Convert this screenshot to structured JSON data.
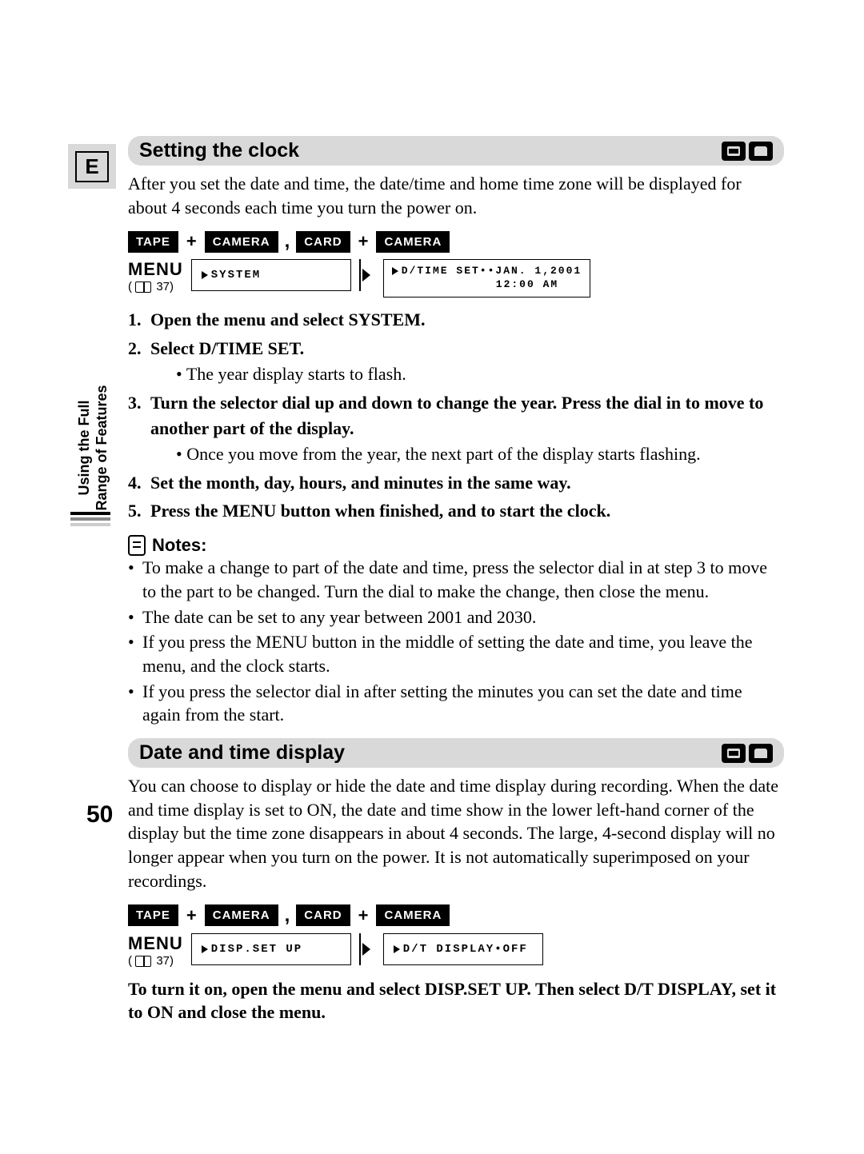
{
  "lang_box": "E",
  "side_label": "Using the Full\nRange of Features",
  "page_number": "50",
  "section1": {
    "title": "Setting the clock",
    "intro": "After you set the date and time, the date/time and home time zone will be displayed for about 4 seconds each time you turn the power on.",
    "tape_row": {
      "tape": "TAPE",
      "camera": "CAMERA",
      "card": "CARD"
    },
    "menu": {
      "label": "MENU",
      "ref_prefix": "(",
      "ref_num": "37)",
      "box1": "SYSTEM",
      "box2_line1": "D/TIME SET••JAN. 1,2001",
      "box2_line2": "12:00 AM"
    },
    "steps": {
      "s1": "Open the menu and select SYSTEM.",
      "s2": "Select D/TIME SET.",
      "s2b": "The year display starts to flash.",
      "s3": "Turn the selector dial up and down to change the year. Press the dial in to move to another part of the display.",
      "s3b": "Once you move from the year, the next part of the display starts flashing.",
      "s4": "Set the month, day, hours, and minutes in the same way.",
      "s5": "Press the MENU button when finished, and to start the clock."
    },
    "notes_title": "Notes:",
    "notes": {
      "n1": "To make a change to part of the date and time, press the selector dial in at step 3 to move to the part to be changed. Turn the dial to make the change, then close the menu.",
      "n2": "The date can be set to any year between 2001 and 2030.",
      "n3": "If you press the MENU button in the middle of setting the date and time, you leave the menu, and the clock starts.",
      "n4": "If you press the selector dial in after setting the minutes you can set the date and time again from the start."
    }
  },
  "section2": {
    "title": "Date and time display",
    "intro": "You can choose to display or hide the date and time display during recording. When the date and time display is set to ON, the date and time show in the lower left-hand corner of the display but the time zone disappears in about 4 seconds. The large, 4-second display will no longer appear when you turn on the power. It is not automatically superimposed on your recordings.",
    "menu": {
      "box1": "DISP.SET UP",
      "box2": "D/T DISPLAY•OFF"
    },
    "closing": "To turn it on, open the menu and select DISP.SET UP. Then select D/T DISPLAY, set it to ON and close the menu."
  }
}
